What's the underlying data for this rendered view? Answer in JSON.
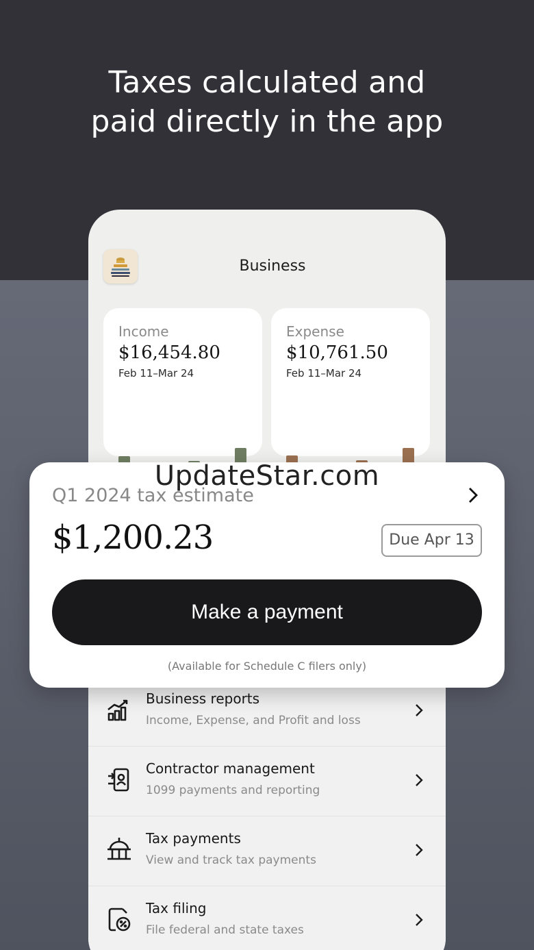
{
  "headline": {
    "line1": "Taxes calculated and",
    "line2": "paid directly in the app"
  },
  "screen": {
    "title": "Business",
    "logo_icon": "bowl-logo-icon"
  },
  "income": {
    "label": "Income",
    "value": "$16,454.80",
    "range": "Feb 11–Mar 24",
    "bar_levels": [
      0.83,
      0.56,
      0.43,
      0.73,
      0.61,
      1.0
    ],
    "color": "#6f7e62"
  },
  "expense": {
    "label": "Expense",
    "value": "$10,761.50",
    "range": "Feb 11–Mar 24",
    "bar_levels": [
      0.84,
      0.56,
      0.44,
      0.74,
      0.62,
      1.0
    ],
    "color": "#9a7050"
  },
  "tax_card": {
    "label": "Q1 2024 tax estimate",
    "amount": "$1,200.23",
    "due": "Due Apr 13",
    "button_label": "Make a payment",
    "note": "(Available for Schedule C filers only)"
  },
  "watermark": "UpdateStar.com",
  "list": [
    {
      "title": "Business reports",
      "subtitle": "Income, Expense, and Profit and loss",
      "icon": "bar-chart-icon"
    },
    {
      "title": "Contractor management",
      "subtitle": "1099 payments and reporting",
      "icon": "contractor-icon"
    },
    {
      "title": "Tax payments",
      "subtitle": "View and track tax payments",
      "icon": "government-building-icon"
    },
    {
      "title": "Tax filing",
      "subtitle": "File federal and state taxes",
      "icon": "tax-document-icon"
    }
  ]
}
